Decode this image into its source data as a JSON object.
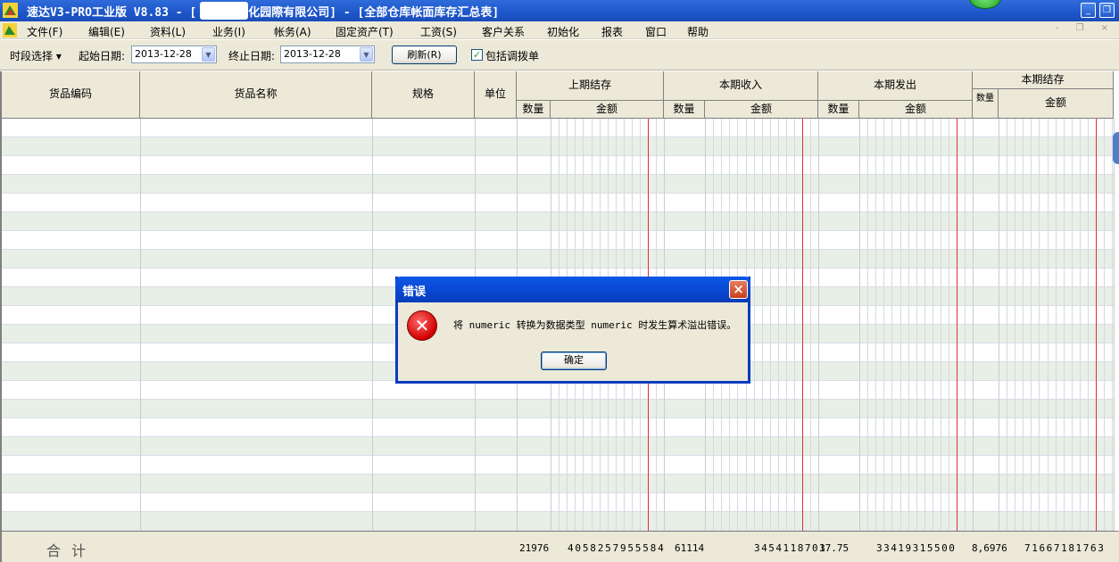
{
  "window": {
    "title": "速达V3-PRO工业版 V8.83 - [",
    "title_suffix": "化园際有限公司] - [全部仓库帐面库存汇总表]",
    "minimize": "_",
    "restore": "❐",
    "icon": "app-logo-icon"
  },
  "menu": {
    "items": [
      "文件(F)",
      "编辑(E)",
      "资料(L)",
      "业务(I)",
      "帐务(A)",
      "固定资产(T)",
      "工资(S)",
      "客户关系",
      "初始化",
      "报表",
      "窗口",
      "帮助"
    ],
    "mdi_controls": "- ❐ ×"
  },
  "toolbar": {
    "period_label": "时段选择 ▾",
    "start_label": "起始日期:",
    "start_date": "2013-12-28",
    "end_label": "终止日期:",
    "end_date": "2013-12-28",
    "refresh_label": "刷新(R)",
    "include_transfer_label": "包括调拨单",
    "include_transfer_checked": true
  },
  "grid": {
    "headers": {
      "code": "货品编码",
      "name": "货品名称",
      "spec": "规格",
      "unit": "单位",
      "prev_balance": "上期结存",
      "period_in": "本期收入",
      "period_out": "本期发出",
      "period_balance": "本期结存",
      "qty": "数量",
      "amount": "金额",
      "qty_narrow": "数量"
    },
    "totals": {
      "label": "合计",
      "prev_qty": "21976",
      "prev_amount": "4058257955584",
      "in_qty": "61114",
      "in_amount": "3454118703",
      "out_qty": "17.75",
      "out_amount": "33419315500",
      "bal_qty": "8,6976",
      "bal_amount": "71667181763"
    }
  },
  "dialog": {
    "title": "错误",
    "message": "将 numeric 转换为数据类型 numeric 时发生算术溢出错误。",
    "ok_label": "确定",
    "close": "×",
    "icon": "error-icon"
  }
}
